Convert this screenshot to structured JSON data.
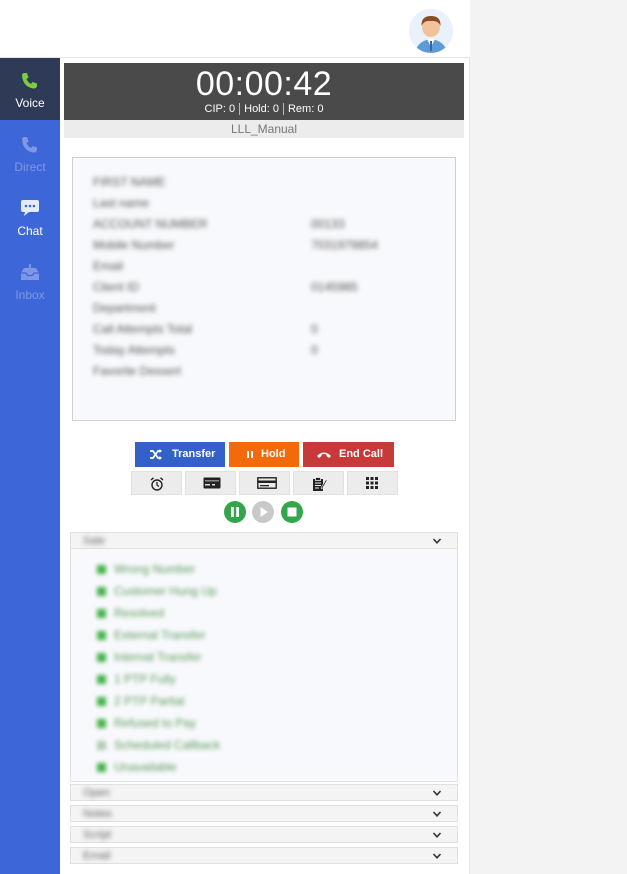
{
  "header": {
    "avatar_icon": "user-avatar-icon"
  },
  "sidebar": {
    "items": [
      {
        "label": "Voice",
        "icon": "phone-icon",
        "state": "active"
      },
      {
        "label": "Direct",
        "icon": "phone-icon",
        "state": "disabled"
      },
      {
        "label": "Chat",
        "icon": "chat-icon",
        "state": "enabled"
      },
      {
        "label": "Inbox",
        "icon": "inbox-icon",
        "state": "disabled"
      }
    ]
  },
  "call": {
    "timer": "00:00:42",
    "stats": {
      "cip": "CIP: 0",
      "hold": "Hold: 0",
      "rem": "Rem: 0"
    },
    "campaign": "LLL_Manual"
  },
  "customer_info": {
    "rows": [
      {
        "key": "FIRST NAME",
        "value": ""
      },
      {
        "key": "Last name",
        "value": ""
      },
      {
        "key": "ACCOUNT NUMBER",
        "value": "00133"
      },
      {
        "key": "Mobile Number",
        "value": "7031979854"
      },
      {
        "key": "Email",
        "value": ""
      },
      {
        "key": "Client ID",
        "value": "0145985"
      },
      {
        "key": "Department",
        "value": ""
      },
      {
        "key": "Call Attempts Total",
        "value": "0"
      },
      {
        "key": "Today Attempts",
        "value": "0"
      },
      {
        "key": "Favorite Dessert",
        "value": ""
      }
    ]
  },
  "actions": {
    "transfer": "Transfer",
    "hold": "Hold",
    "end_call": "End Call"
  },
  "tools": [
    {
      "icon": "alarm-clock-icon"
    },
    {
      "icon": "credit-card-icon"
    },
    {
      "icon": "card-reader-icon"
    },
    {
      "icon": "notes-icon"
    },
    {
      "icon": "dialpad-icon"
    }
  ],
  "recording": {
    "pause_icon": "pause-circle-icon",
    "play_icon": "play-circle-icon",
    "stop_icon": "stop-circle-icon"
  },
  "dispositions": {
    "header": "Sale",
    "items": [
      {
        "label": "Wrong Number",
        "muted": false
      },
      {
        "label": "Customer Hung Up",
        "muted": false
      },
      {
        "label": "Resolved",
        "muted": false
      },
      {
        "label": "External Transfer",
        "muted": false
      },
      {
        "label": "Internal Transfer",
        "muted": false
      },
      {
        "label": "1 PTP Fully",
        "muted": false
      },
      {
        "label": "2 PTP Partial",
        "muted": false
      },
      {
        "label": "Refused to Pay",
        "muted": false
      },
      {
        "label": "Scheduled Callback",
        "muted": true
      },
      {
        "label": "Unavailable",
        "muted": false
      }
    ]
  },
  "sections": [
    {
      "title": "Open"
    },
    {
      "title": "Notes"
    },
    {
      "title": "Script"
    },
    {
      "title": "Email"
    }
  ],
  "colors": {
    "sidebar": "#3d66d8",
    "sidebar_active": "#2f3a56",
    "transfer": "#3461c9",
    "hold": "#f26a0a",
    "end_call": "#c8393a",
    "record_green": "#33a54a"
  }
}
